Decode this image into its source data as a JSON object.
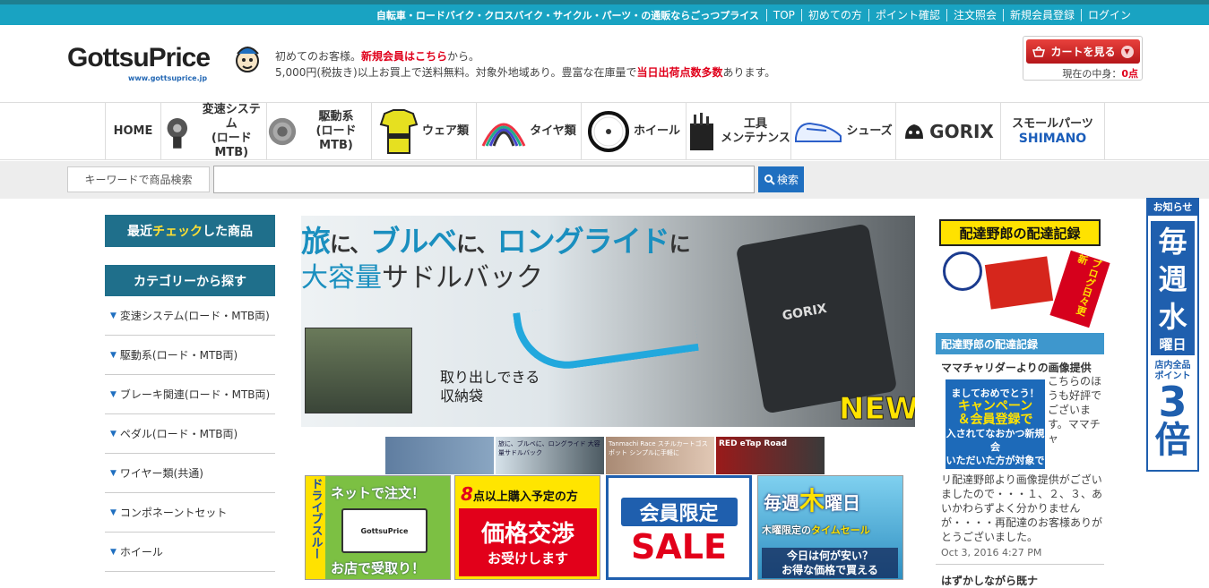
{
  "topbar": {
    "tagline": "自転車・ロードバイク・クロスバイク・サイクル・パーツ・の通販ならごっつプライス",
    "links": [
      "TOP",
      "初めての方",
      "ポイント確認",
      "注文照会",
      "新規会員登録",
      "ログイン"
    ]
  },
  "header": {
    "logo_text": "GottsuPrice",
    "logo_url": "www.gottsuprice.jp",
    "welcome_line1_pre": "初めてのお客様。",
    "welcome_line1_link": "新規会員はこちら",
    "welcome_line1_post": "から。",
    "welcome_line2_pre": "5,000円(税抜き)以上お買上で送料無料。対象外地域あり。豊富な在庫量で",
    "welcome_line2_red": "当日出荷点数多数",
    "welcome_line2_post": "あります。",
    "cart_button": "カートを見る",
    "cart_count_label": "現在の中身：",
    "cart_count": "0点"
  },
  "nav": {
    "items": [
      {
        "label": "HOME",
        "icon": "home"
      },
      {
        "label": "変速システム\n(ロードMTB)",
        "icon": "derailleur-icon"
      },
      {
        "label": "駆動系\n(ロードMTB)",
        "icon": "cassette-icon"
      },
      {
        "label": "ウェア類",
        "icon": "jersey-icon"
      },
      {
        "label": "タイヤ類",
        "icon": "tire-icon"
      },
      {
        "label": "ホイール",
        "icon": "wheel-icon"
      },
      {
        "label": "工具\nメンテナンス",
        "icon": "tools-icon"
      },
      {
        "label": "シューズ",
        "icon": "shoe-icon"
      },
      {
        "label": "GORIX",
        "icon": "gorix-logo"
      },
      {
        "label": "スモールパーツ",
        "sub": "SHIMANO",
        "icon": "shimano-logo"
      }
    ]
  },
  "search": {
    "label": "キーワードで商品検索",
    "value": "",
    "button": "検索"
  },
  "sidebar": {
    "recent_pre": "最近",
    "recent_highlight": "チェック",
    "recent_post": "した商品",
    "category_heading": "カテゴリーから探す",
    "categories": [
      "変速システム(ロード・MTB両)",
      "駆動系(ロード・MTB両)",
      "ブレーキ関連(ロード・MTB両)",
      "ペダル(ロード・MTB両)",
      "ワイヤー類(共通)",
      "コンポネーントセット",
      "ホイール"
    ]
  },
  "banner": {
    "line1_a": "旅",
    "line1_b": "に、",
    "line1_c": "ブルベ",
    "line1_d": "に、",
    "line1_e": "ロングライド",
    "line1_f": "に",
    "line2_a": "大容量",
    "line2_b": "サドルバック",
    "caption_1": "取り出しできる",
    "caption_2": "収納袋",
    "badge": "NEW",
    "bag_brand": "GORIX"
  },
  "thumbs": [
    {
      "text": ""
    },
    {
      "text": "旅に、ブルベに、ロングライド 大容量サドルバック"
    },
    {
      "text": "Tanmachi Race スチルカートゴスポット シンプルに手軽に"
    },
    {
      "text": "RED eTap Road"
    }
  ],
  "promos": {
    "p1_side": "ドライブスルー",
    "p1_head": "ネットで注文！",
    "p1_device": "GottsuPrice",
    "p1_foot": "お店で受取り！",
    "p2_num": "8",
    "p2_head": "点以上購入予定の方",
    "p2_big": "価格交渉",
    "p2_small": "お受けします",
    "p3_head": "会員限定",
    "p3_sale": "SALE",
    "p4_head_a": "毎週",
    "p4_head_m": "木",
    "p4_head_b": "曜日",
    "p4_sub_a": "木曜限定の",
    "p4_sub_b": "タイムセール",
    "p4_q1": "今日は何が安い？",
    "p4_q2": "お得な価格で買える"
  },
  "right": {
    "blog_banner_title": "配達野郎の配達記録",
    "blog_banner_tag": "ブログ日々更新",
    "blog_heading": "配達野郎の配達記録",
    "post_title": "ママチャリダーよりの画像提供",
    "post_img_line1": "ましておめでとう！",
    "post_img_line2": "キャンペーン",
    "post_img_line3": "＆会員登録で",
    "post_img_line4": "入されてなおかつ新規会",
    "post_img_line5": "いただいた方が対象です",
    "post_body_1": "こちらのほうも好評でございます。ママチャ",
    "post_body_2": "リ配達野郎より画像提供がございましたので・・・１、２、３、あいかわらずよく分かりませんが・・・・再配達のお客様ありがとうございました。",
    "post_date": "Oct 3, 2016 4:27 PM",
    "next_title": "はずかしながら既ナ"
  },
  "notice": {
    "head": "お知らせ",
    "big1": "毎",
    "big2": "週",
    "big3": "水",
    "day": "曜日",
    "points_1": "店内全品",
    "points_2": "ポイント",
    "multiplier": "3",
    "suffix": "倍"
  }
}
